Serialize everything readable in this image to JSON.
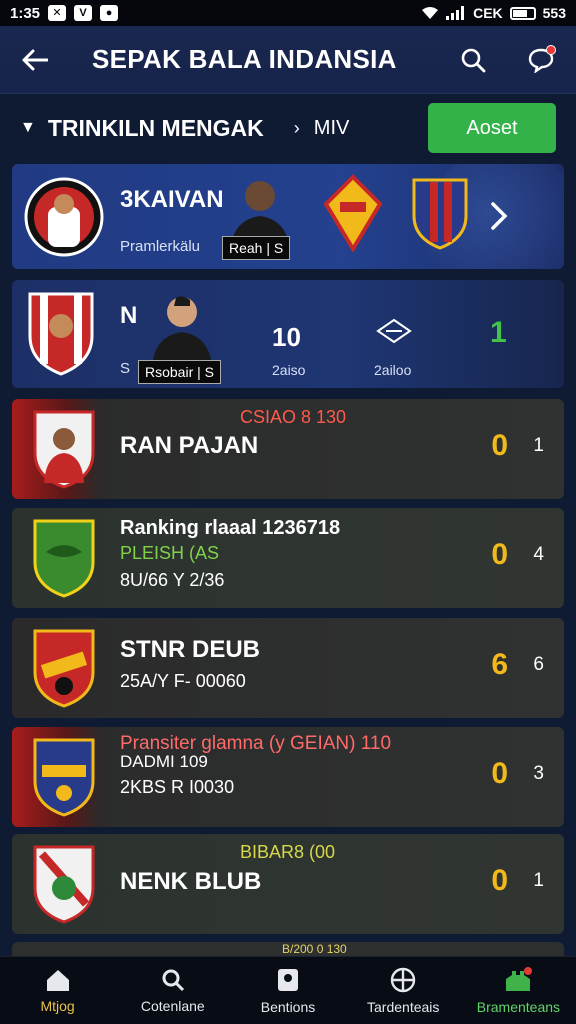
{
  "status_bar": {
    "time": "1:35",
    "right_text": "CEK",
    "battery_text": "553"
  },
  "header": {
    "title": "SEPAK BALA INDANSIA"
  },
  "filter": {
    "label": "TRINKILN MENGAK",
    "sub": "MIV",
    "action_label": "Aoset"
  },
  "featured": [
    {
      "name": "3KAIVAN",
      "sub": "Pramlerkälu",
      "player_tag": "Reah | S"
    },
    {
      "name": "N",
      "sub": "S",
      "player_tag": "Rsobair | S",
      "value": "10",
      "value_label": "2aiso",
      "stat_label": "2ailoo",
      "stat_value": "1"
    }
  ],
  "matches": [
    {
      "header": "CSIAO 8 130",
      "name": "RAN PAJAN",
      "line1": "",
      "line2": "",
      "score": "0",
      "count": "1",
      "stripe": "#a81c1c",
      "header_color": "#ff5a4a"
    },
    {
      "header": "",
      "name": "Ranking rlaaal 1236718",
      "line1": "PLEISH (AS",
      "line2": "8U/66 Y 2/36",
      "score": "0",
      "count": "4",
      "stripe": "",
      "line1_color": "#7fd34a"
    },
    {
      "header": "",
      "name": "STNR DEUB",
      "line1": "25A/Y F- 00060",
      "line2": "",
      "score": "6",
      "count": "6",
      "stripe": ""
    },
    {
      "header": "Pransiter glamna (y GEIAN) 110",
      "name": "",
      "line1": "DADMI 109",
      "line2": "2KBS R I0030",
      "score": "0",
      "count": "3",
      "stripe": "#a81c1c",
      "header_color": "#ff6a6a"
    },
    {
      "header": "BIBAR8 (00",
      "name": "NENK BLUB",
      "line1": "",
      "line2": "",
      "score": "0",
      "count": "1",
      "stripe": "",
      "header_color": "#d6d84a"
    }
  ],
  "peek": {
    "text": "B/200 0 130"
  },
  "bottom_nav": [
    {
      "label": "Mtjog",
      "icon": "home-icon"
    },
    {
      "label": "Cotenlane",
      "icon": "search-icon"
    },
    {
      "label": "Bentions",
      "icon": "trophy-icon"
    },
    {
      "label": "Tardenteais",
      "icon": "crosshair-icon"
    },
    {
      "label": "Bramenteans",
      "icon": "stadium-icon"
    }
  ],
  "colors": {
    "accent_green": "#34b24a",
    "score_yellow": "#f2b91a",
    "header_bg": "#1a2750",
    "page_bg": "#0f1a33"
  }
}
